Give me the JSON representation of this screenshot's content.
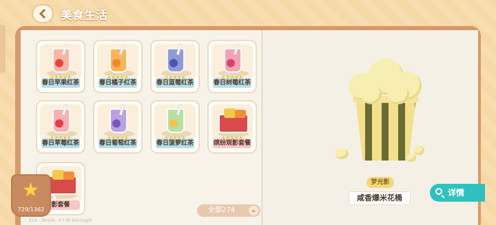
{
  "header": {
    "title": "美食生活"
  },
  "cards": [
    {
      "label": "春日苹果红茶",
      "stars": "★★★★★",
      "drink": "#f5b7a4",
      "fruit": "#e6463f"
    },
    {
      "label": "春日橘子红茶",
      "stars": "★★★★★",
      "drink": "#f7b45a",
      "fruit": "#f08b2b"
    },
    {
      "label": "春日蓝莓红茶",
      "stars": "★★★★★",
      "drink": "#8f9bd9",
      "fruit": "#4b55b2"
    },
    {
      "label": "春日树莓红茶",
      "stars": "★★★★★",
      "drink": "#f2a3b4",
      "fruit": "#d8456a"
    },
    {
      "label": "春日草莓红茶",
      "stars": "★★★★★",
      "drink": "#f7b1b3",
      "fruit": "#e53b4a"
    },
    {
      "label": "春日葡萄红茶",
      "stars": "★★★★★",
      "drink": "#b9a2df",
      "fruit": "#7b55bf"
    },
    {
      "label": "春日菠萝红茶",
      "stars": "★★★★★",
      "drink": "#b8e0a0",
      "fruit": "#f2c24a"
    },
    {
      "label": "缤纷观影套餐",
      "stars": "★★★★★",
      "meal": true
    },
    {
      "label": "影套餐",
      "stars": "",
      "meal": true
    }
  ],
  "footer": {
    "total": "全部274",
    "progress": "729/1362",
    "tiny": "ID.b...2b(e)b...b   f 6b   ba(a)sg(b"
  },
  "detail": {
    "tag": "梦光影",
    "name": "咸香爆米花桶",
    "details_button": "详情"
  },
  "colors": {
    "accent": "#2ec1c0",
    "book": "#d59a6c",
    "label_blue": "#b7dfe8",
    "label_pink": "#f7c8c9"
  },
  "icons": {
    "back": "chevron-left-icon",
    "details": "search-icon",
    "progress": "star-icon",
    "scroll_up": "chevron-up-icon"
  }
}
